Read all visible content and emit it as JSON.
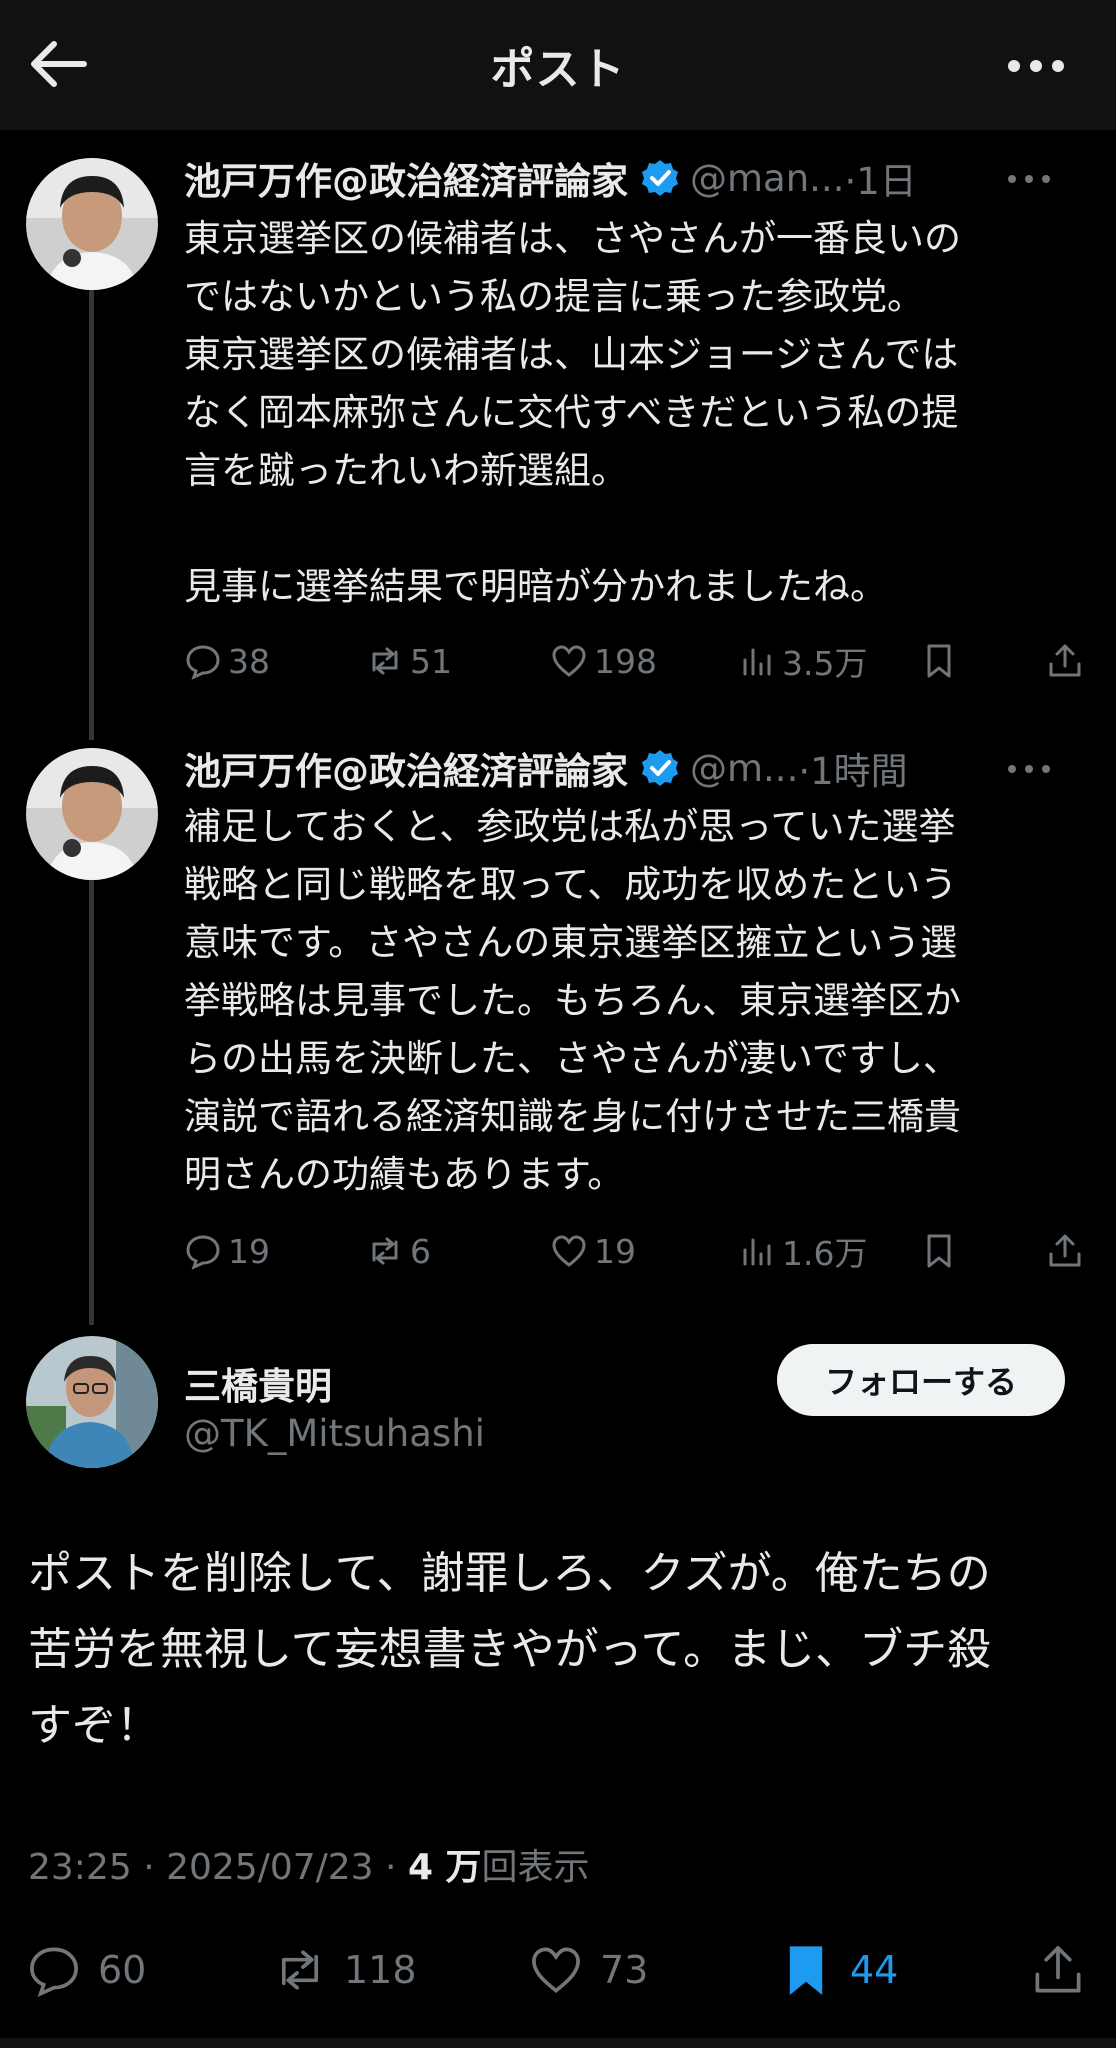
{
  "header": {
    "title": "ポスト",
    "back_icon": "arrow-left-icon",
    "more_icon": "more-dots-icon"
  },
  "posts": [
    {
      "name": "池戸万作@政治経済評論家",
      "handle": "@man...",
      "time": "·1日",
      "text": "東京選挙区の候補者は、さやさんが一番良いの\nではないかという私の提言に乗った参政党。\n東京選挙区の候補者は、山本ジョージさんでは\nなく岡本麻弥さんに交代すべきだという私の提\n言を蹴ったれいわ新選組。\n\n見事に選挙結果で明暗が分かれましたね。",
      "replies": "38",
      "reposts": "51",
      "likes": "198",
      "views": "3.5万"
    },
    {
      "name": "池戸万作@政治経済評論家",
      "handle": "@m...",
      "time": "·1時間",
      "text": "補足しておくと、参政党は私が思っていた選挙\n戦略と同じ戦略を取って、成功を収めたという\n意味です。さやさんの東京選挙区擁立という選\n挙戦略は見事でした。もちろん、東京選挙区か\nらの出馬を決断した、さやさんが凄いですし、\n演説で語れる経済知識を身に付けさせた三橋貴\n明さんの功績もあります。",
      "replies": "19",
      "reposts": "6",
      "likes": "19",
      "views": "1.6万"
    }
  ],
  "main_post": {
    "name": "三橋貴明",
    "handle": "@TK_Mitsuhashi",
    "follow_label": "フォローする",
    "text": "ポストを削除して、謝罪しろ、クズが。俺たちの\n苦労を無視して妄想書きやがって。まじ、ブチ殺\nすぞ！",
    "time": "23:25",
    "date": "2025/07/23",
    "views_count": "4 万",
    "views_label": "回表示",
    "replies": "60",
    "reposts": "118",
    "likes": "73",
    "bookmarks": "44"
  },
  "colors": {
    "background": "#000000",
    "accent": "#1d9bf0",
    "muted": "#71767b",
    "verified": "#1d9bf0"
  }
}
